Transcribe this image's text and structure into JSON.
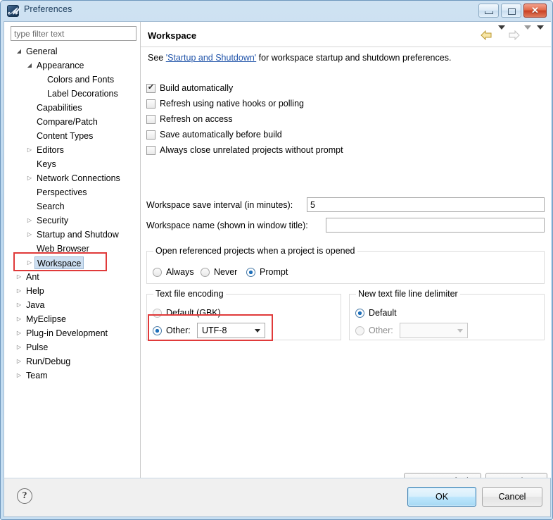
{
  "window": {
    "title": "Preferences",
    "icon": "preferences-icon",
    "controls": {
      "minimize": "minimize-button",
      "maximize": "maximize-button",
      "close": "close-button"
    }
  },
  "sidebar": {
    "filter_placeholder": "type filter text",
    "filter_value": "",
    "tree": [
      {
        "label": "General",
        "indent": 0,
        "arrow": "expanded",
        "selected": false
      },
      {
        "label": "Appearance",
        "indent": 1,
        "arrow": "expanded",
        "selected": false
      },
      {
        "label": "Colors and Fonts",
        "indent": 2,
        "arrow": "none",
        "selected": false
      },
      {
        "label": "Label Decorations",
        "indent": 2,
        "arrow": "none",
        "selected": false
      },
      {
        "label": "Capabilities",
        "indent": 1,
        "arrow": "none",
        "selected": false
      },
      {
        "label": "Compare/Patch",
        "indent": 1,
        "arrow": "none",
        "selected": false
      },
      {
        "label": "Content Types",
        "indent": 1,
        "arrow": "none",
        "selected": false
      },
      {
        "label": "Editors",
        "indent": 1,
        "arrow": "collapsed",
        "selected": false
      },
      {
        "label": "Keys",
        "indent": 1,
        "arrow": "none",
        "selected": false
      },
      {
        "label": "Network Connections",
        "indent": 1,
        "arrow": "collapsed",
        "selected": false
      },
      {
        "label": "Perspectives",
        "indent": 1,
        "arrow": "none",
        "selected": false
      },
      {
        "label": "Search",
        "indent": 1,
        "arrow": "none",
        "selected": false
      },
      {
        "label": "Security",
        "indent": 1,
        "arrow": "collapsed",
        "selected": false
      },
      {
        "label": "Startup and Shutdow",
        "indent": 1,
        "arrow": "collapsed",
        "selected": false
      },
      {
        "label": "Web Browser",
        "indent": 1,
        "arrow": "none",
        "selected": false
      },
      {
        "label": "Workspace",
        "indent": 1,
        "arrow": "collapsed",
        "selected": true
      },
      {
        "label": "Ant",
        "indent": 0,
        "arrow": "collapsed",
        "selected": false
      },
      {
        "label": "Help",
        "indent": 0,
        "arrow": "collapsed",
        "selected": false
      },
      {
        "label": "Java",
        "indent": 0,
        "arrow": "collapsed",
        "selected": false
      },
      {
        "label": "MyEclipse",
        "indent": 0,
        "arrow": "collapsed",
        "selected": false
      },
      {
        "label": "Plug-in Development",
        "indent": 0,
        "arrow": "collapsed",
        "selected": false
      },
      {
        "label": "Pulse",
        "indent": 0,
        "arrow": "collapsed",
        "selected": false
      },
      {
        "label": "Run/Debug",
        "indent": 0,
        "arrow": "collapsed",
        "selected": false
      },
      {
        "label": "Team",
        "indent": 0,
        "arrow": "collapsed",
        "selected": false
      }
    ],
    "scrollbar": {
      "left_arrow": "◀",
      "right_arrow": "▶",
      "grip": "❘❘❘"
    }
  },
  "main": {
    "title": "Workspace",
    "nav": {
      "back": "back-arrow",
      "back_dropdown": "back-dropdown",
      "forward": "forward-arrow",
      "forward_dropdown": "forward-dropdown",
      "menu": "view-menu"
    },
    "description": {
      "prefix": "See ",
      "link": "'Startup and Shutdown'",
      "suffix": " for workspace startup and shutdown preferences."
    },
    "checkboxes": [
      {
        "label": "Build automatically",
        "checked": true
      },
      {
        "label": "Refresh using native hooks or polling",
        "checked": false
      },
      {
        "label": "Refresh on access",
        "checked": false
      },
      {
        "label": "Save automatically before build",
        "checked": false
      },
      {
        "label": "Always close unrelated projects without prompt",
        "checked": false
      }
    ],
    "fields": [
      {
        "label": "Workspace save interval (in minutes):",
        "value": "5"
      },
      {
        "label": "Workspace name (shown in window title):",
        "value": ""
      }
    ],
    "referenced_projects": {
      "title": "Open referenced projects when a project is opened",
      "options": [
        {
          "label": "Always",
          "selected": false
        },
        {
          "label": "Never",
          "selected": false
        },
        {
          "label": "Prompt",
          "selected": true
        }
      ]
    },
    "text_file_encoding": {
      "title": "Text file encoding",
      "default_label": "Default (GBK)",
      "default_selected": false,
      "other_label": "Other:",
      "other_selected": true,
      "other_value": "UTF-8"
    },
    "line_delimiter": {
      "title": "New text file line delimiter",
      "default_label": "Default",
      "default_selected": true,
      "other_label": "Other:",
      "other_selected": false,
      "other_value": ""
    },
    "buttons": {
      "restore_defaults": "Restore Defaults",
      "apply": "Apply"
    }
  },
  "footer": {
    "help": "?",
    "ok": "OK",
    "cancel": "Cancel"
  },
  "annotations": {
    "highlight_color": "#e03a3a",
    "items": [
      {
        "name": "workspace-tree-item-highlight"
      },
      {
        "name": "text-file-encoding-other-highlight"
      }
    ]
  }
}
